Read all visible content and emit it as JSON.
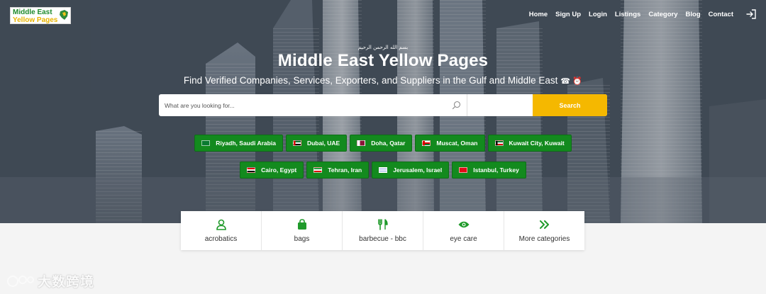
{
  "logo": {
    "line1": "Middle East",
    "line2": "Yellow Pages"
  },
  "nav": {
    "items": [
      "Home",
      "Sign Up",
      "Login",
      "Listings",
      "Category",
      "Blog",
      "Contact"
    ],
    "login_icon": "sign-in-icon"
  },
  "hero": {
    "arabic": "بسم الله الرحمن الرحيم",
    "title": "Middle East Yellow Pages",
    "subtitle": "Find Verified Companies, Services, Exporters, and Suppliers in the Gulf and Middle East",
    "subtitle_emoji": "☎ ⏰"
  },
  "search": {
    "placeholder": "What are you looking for...",
    "value": "",
    "button_label": "Search",
    "accent": "#f5b800"
  },
  "cities": {
    "row1": [
      {
        "label": "Riyadh, Saudi Arabia",
        "flag": "sa"
      },
      {
        "label": "Dubai, UAE",
        "flag": "ae"
      },
      {
        "label": "Doha, Qatar",
        "flag": "qa"
      },
      {
        "label": "Muscat, Oman",
        "flag": "om"
      },
      {
        "label": "Kuwait City, Kuwait",
        "flag": "kw"
      }
    ],
    "row2": [
      {
        "label": "Cairo, Egypt",
        "flag": "eg"
      },
      {
        "label": "Tehran, Iran",
        "flag": "ir"
      },
      {
        "label": "Jerusalem, Israel",
        "flag": "il"
      },
      {
        "label": "Istanbul, Turkey",
        "flag": "tr"
      }
    ],
    "chip_color": "#138a1e"
  },
  "categories": [
    {
      "label": "acrobatics",
      "icon": "user-icon"
    },
    {
      "label": "bags",
      "icon": "shopping-bag-icon"
    },
    {
      "label": "barbecue - bbc",
      "icon": "utensils-icon"
    },
    {
      "label": "eye care",
      "icon": "eye-icon"
    },
    {
      "label": "More categories",
      "icon": "double-chevron-right-icon"
    }
  ],
  "category_icon_color": "#1f9a2a",
  "watermark": {
    "text": "大数跨境"
  }
}
